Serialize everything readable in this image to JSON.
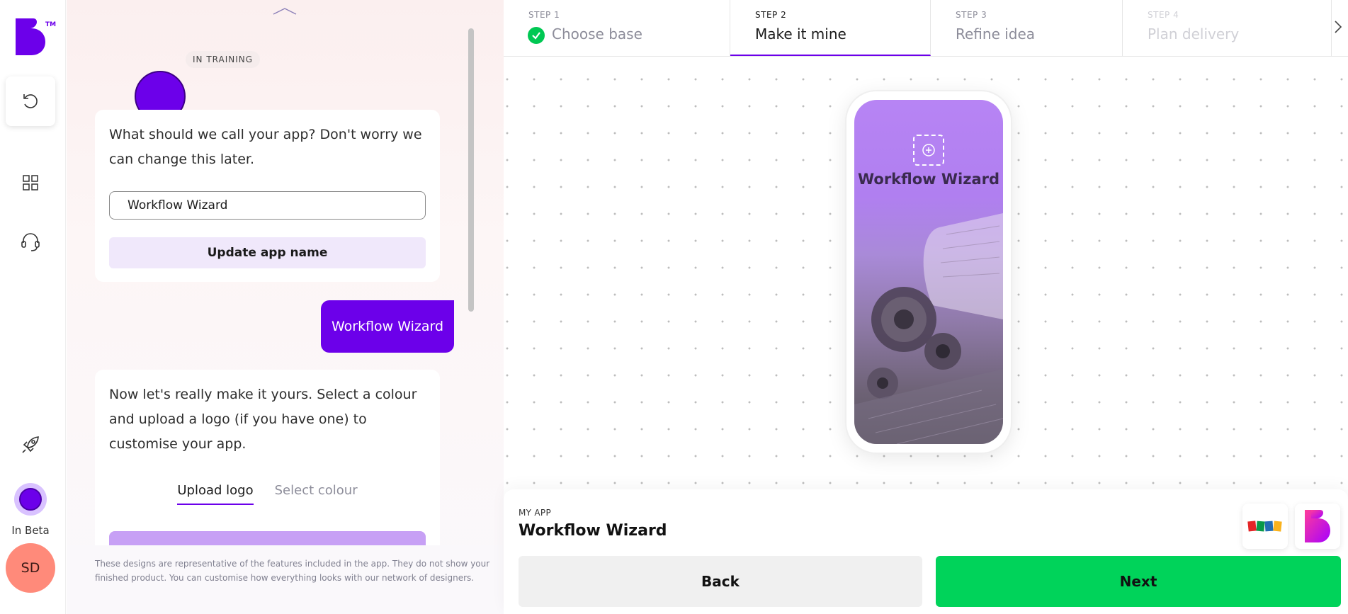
{
  "rail": {
    "logo_icon": "builder-logo-icon",
    "logo_tm": "TM",
    "undo_icon": "undo-icon",
    "grid_icon": "grid-icon",
    "support_icon": "headset-icon",
    "rocket_icon": "rocket-icon",
    "beta_label": "In Beta",
    "avatar_initials": "SD"
  },
  "chat": {
    "training_badge": "IN TRAINING",
    "name_prompt": "What should we call your app? Don't worry we can change this later.",
    "name_input_value": "Workflow Wizard",
    "update_button": "Update app name",
    "user_reply": "Workflow Wizard",
    "customise_prompt": "Now let's really make it yours. Select a colour and upload a logo (if you have one) to customise your app.",
    "tabs": [
      {
        "label": "Upload logo",
        "active": true
      },
      {
        "label": "Select colour",
        "active": false
      }
    ],
    "disclaimer": "These designs are representative of the features included in the app. They do not show your finished product. You can customise how everything looks with our network of designers."
  },
  "stepper": {
    "steps": [
      {
        "number": "STEP 1",
        "title": "Choose base",
        "status": "complete"
      },
      {
        "number": "STEP 2",
        "title": "Make it mine",
        "status": "active"
      },
      {
        "number": "STEP 3",
        "title": "Refine idea",
        "status": "upcoming"
      },
      {
        "number": "STEP 4",
        "title": "Plan delivery",
        "status": "disabled"
      }
    ]
  },
  "preview": {
    "app_title": "Workflow Wizard",
    "add_logo_icon": "plus-circle-icon"
  },
  "footer": {
    "my_app_label": "MY APP",
    "my_app_name": "Workflow Wizard",
    "back_button": "Back",
    "next_button": "Next",
    "zoho_logo_text": "ZOHO"
  },
  "colors": {
    "brand_purple": "#6c00ea",
    "next_green": "#00d35a",
    "avatar_salmon": "#ff8a7a"
  }
}
